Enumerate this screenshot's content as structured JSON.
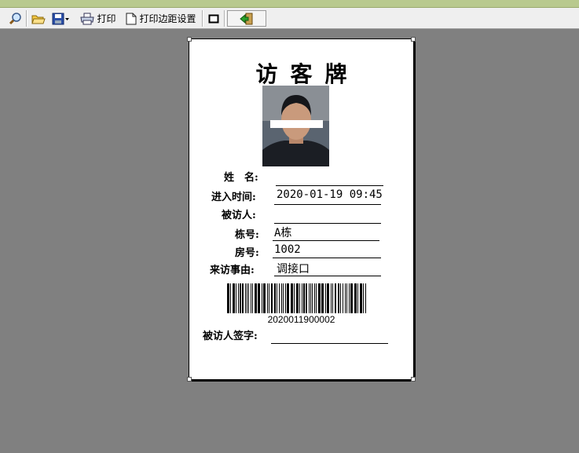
{
  "toolbar": {
    "print_label": "打印",
    "margin_label": "打印边距设置"
  },
  "badge": {
    "title": "访客牌",
    "name_label": "姓　名:",
    "name_value": "",
    "entry_time_label": "进入时间:",
    "entry_time_value": "2020-01-19 09:45",
    "visited_label": "被访人:",
    "visited_value": "",
    "building_label": "栋号:",
    "building_value": "A栋",
    "room_label": "房号:",
    "room_value": "1002",
    "reason_label": "来访事由:",
    "reason_value": "调接口",
    "barcode_number": "2020011900002",
    "signature_label": "被访人签字:"
  }
}
